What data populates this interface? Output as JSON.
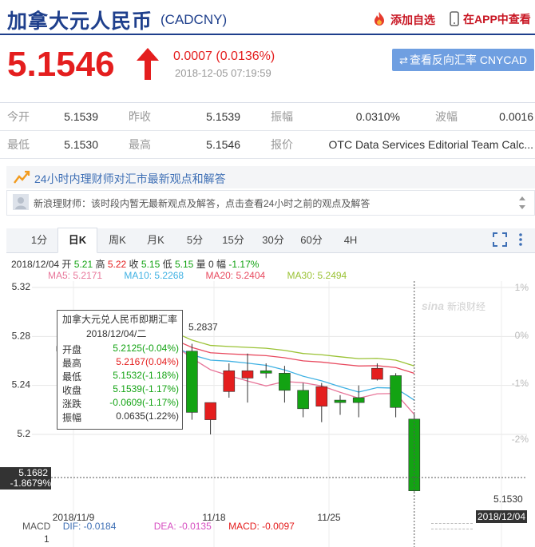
{
  "header": {
    "title": "加拿大元人民币",
    "code": "(CADCNY)",
    "fav_label": "添加自选",
    "app_label": "在APP中查看"
  },
  "quote": {
    "price": "5.1546",
    "change": "0.0007 (0.0136%)",
    "time": "2018-12-05 07:19:59",
    "reverse_label": "查看反向汇率 CNYCAD"
  },
  "stats": {
    "rows": [
      [
        {
          "label": "今开",
          "value": "5.1539"
        },
        {
          "label": "昨收",
          "value": "5.1539"
        },
        {
          "label": "振幅",
          "value": "0.0310%"
        },
        {
          "label": "波幅",
          "value": "0.0016"
        }
      ],
      [
        {
          "label": "最低",
          "value": "5.1530"
        },
        {
          "label": "最高",
          "value": "5.1546"
        },
        {
          "label": "报价",
          "value": "OTC Data Services Editorial Team Calc..."
        }
      ]
    ]
  },
  "advisor": {
    "title": "24小时内理财师对汇市最新观点和解答",
    "message": "新浪理财师：该时段内暂无最新观点及解答，点击查看24小时之前的观点及解答"
  },
  "tabs": [
    "1分",
    "日K",
    "周K",
    "月K",
    "5分",
    "15分",
    "30分",
    "60分",
    "4H"
  ],
  "active_tab": "日K",
  "info": {
    "date": "2018/12/04",
    "open_label": "开",
    "open": "5.21",
    "high_label": "高",
    "high": "5.22",
    "close_label": "收",
    "close": "5.15",
    "low_label": "低",
    "low": "5.15",
    "vol_label": "量",
    "vol": "0",
    "amp_label": "幅",
    "amp": "-1.17%"
  },
  "ma": {
    "ma5": "MA5: 5.2171",
    "ma10": "MA10: 5.2268",
    "ma20": "MA20: 5.2404",
    "ma30": "MA30: 5.2494"
  },
  "colors": {
    "up": "#e41e1e",
    "down": "#13a313",
    "ma5": "#e8769a",
    "ma10": "#3fb1e3",
    "ma20": "#e84a5f",
    "ma30": "#9ac234",
    "brand": "#1e3f8c"
  },
  "tooltip": {
    "title": "加拿大元兑人民币即期汇率",
    "date": "2018/12/04/二",
    "rows": [
      {
        "label": "开盘",
        "value": "5.2125(-0.04%)",
        "dir": "down"
      },
      {
        "label": "最高",
        "value": "5.2167(0.04%)",
        "dir": "up"
      },
      {
        "label": "最低",
        "value": "5.1532(-1.18%)",
        "dir": "down"
      },
      {
        "label": "收盘",
        "value": "5.1539(-1.17%)",
        "dir": "down"
      },
      {
        "label": "涨跌",
        "value": "-0.0609(-1.17%)",
        "dir": "down"
      },
      {
        "label": "振幅",
        "value": "0.0635(1.22%)",
        "dir": "neutral"
      }
    ]
  },
  "chart_data": {
    "type": "candlestick",
    "y_ticks": [
      "5.32",
      "5.28",
      "5.24",
      "5.2"
    ],
    "pct_ticks": [
      "1%",
      "0%",
      "-1%",
      "-2%"
    ],
    "x_ticks": [
      "2018/11/9",
      "11/18",
      "11/25"
    ],
    "ylim": [
      5.145,
      5.33
    ],
    "crosshair_price": "5.1682",
    "crosshair_pct": "-1.8679%",
    "crosshair_date": "2018/12/04",
    "high_label": "5.2837",
    "low_label": "5.1530",
    "watermark": "新浪财经",
    "candles": [
      {
        "open": 5.272,
        "high": 5.276,
        "low": 5.265,
        "close": 5.268
      },
      {
        "open": 5.266,
        "high": 5.27,
        "low": 5.262,
        "close": 5.268
      },
      {
        "open": 5.267,
        "high": 5.275,
        "low": 5.262,
        "close": 5.273
      },
      {
        "open": 5.268,
        "high": 5.28,
        "low": 5.26,
        "close": 5.273
      },
      {
        "open": 5.27,
        "high": 5.2837,
        "low": 5.262,
        "close": 5.276
      },
      {
        "open": 5.262,
        "high": 5.278,
        "low": 5.258,
        "close": 5.274
      },
      {
        "open": 5.272,
        "high": 5.276,
        "low": 5.268,
        "close": 5.27
      },
      {
        "open": 5.268,
        "high": 5.274,
        "low": 5.212,
        "close": 5.218
      },
      {
        "open": 5.212,
        "high": 5.216,
        "low": 5.2,
        "close": 5.226
      },
      {
        "open": 5.235,
        "high": 5.258,
        "low": 5.23,
        "close": 5.252
      },
      {
        "open": 5.246,
        "high": 5.266,
        "low": 5.226,
        "close": 5.252
      },
      {
        "open": 5.252,
        "high": 5.258,
        "low": 5.246,
        "close": 5.25
      },
      {
        "open": 5.25,
        "high": 5.256,
        "low": 5.226,
        "close": 5.236
      },
      {
        "open": 5.236,
        "high": 5.242,
        "low": 5.214,
        "close": 5.221
      },
      {
        "open": 5.223,
        "high": 5.242,
        "low": 5.21,
        "close": 5.239
      },
      {
        "open": 5.228,
        "high": 5.232,
        "low": 5.216,
        "close": 5.226
      },
      {
        "open": 5.23,
        "high": 5.24,
        "low": 5.214,
        "close": 5.226
      },
      {
        "open": 5.245,
        "high": 5.258,
        "low": 5.244,
        "close": 5.254
      },
      {
        "open": 5.248,
        "high": 5.25,
        "low": 5.214,
        "close": 5.222
      },
      {
        "open": 5.2125,
        "high": 5.2167,
        "low": 5.1532,
        "close": 5.1539
      }
    ]
  },
  "macd": {
    "label": "MACD",
    "dif": "DIF: -0.0184",
    "dea": "DEA: -0.0135",
    "macd": "MACD: -0.0097",
    "axis_tick": "1"
  }
}
